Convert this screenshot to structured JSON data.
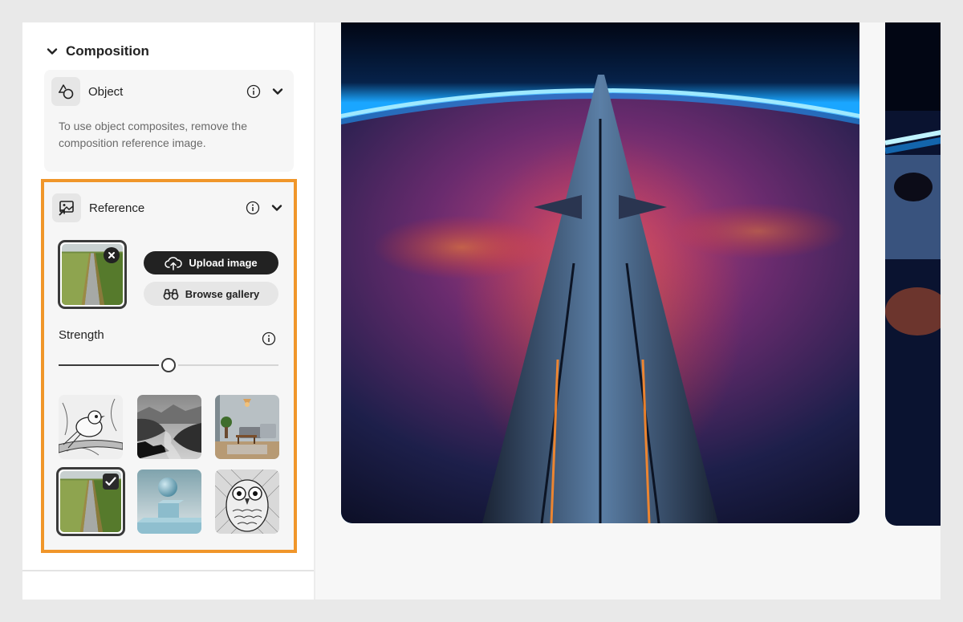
{
  "composition": {
    "title": "Composition",
    "object": {
      "title": "Object",
      "description": "To use object composites, remove the composition reference image."
    },
    "reference": {
      "title": "Reference",
      "current_image": "road-through-fields-thumbnail",
      "upload_label": "Upload image",
      "browse_label": "Browse gallery",
      "strength_label": "Strength",
      "strength_value": 0.5,
      "gallery": [
        {
          "name": "bird-sketch",
          "selected": false
        },
        {
          "name": "misty-mountain-lake",
          "selected": false
        },
        {
          "name": "living-room-interior",
          "selected": false
        },
        {
          "name": "road-through-fields",
          "selected": true
        },
        {
          "name": "sphere-on-cube",
          "selected": false
        },
        {
          "name": "owl-sketch",
          "selected": false
        }
      ]
    }
  },
  "results": [
    {
      "name": "spaceship-over-planet",
      "visible": "full"
    },
    {
      "name": "planet-with-moon",
      "visible": "partial"
    }
  ],
  "colors": {
    "highlight": "#f0962a",
    "primary_button": "#222222",
    "secondary_button": "#e6e6e6"
  }
}
